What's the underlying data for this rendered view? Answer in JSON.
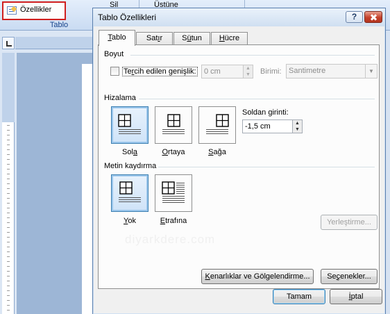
{
  "ribbon": {
    "properties_label": "Özellikler",
    "group_label": "Tablo",
    "delete_label": "Sil",
    "above_label": "Üstüne"
  },
  "dialog": {
    "title": "Tablo Özellikleri",
    "help_label": "?",
    "tabs": [
      {
        "label": "Tablo",
        "ul": "T",
        "rest": "ablo",
        "active": true
      },
      {
        "label": "Satır",
        "pre": "Sat",
        "ul": "ı",
        "rest": "r",
        "active": false
      },
      {
        "label": "Sütun",
        "pre": "S",
        "ul": "ü",
        "rest": "tun",
        "active": false
      },
      {
        "label": "Hücre",
        "ul": "H",
        "rest": "ücre",
        "active": false
      }
    ],
    "size": {
      "section_label": "Boyut",
      "preferred_width": {
        "pre": "Te",
        "ul": "r",
        "rest": "cih edilen genişlik:",
        "checked": false
      },
      "width_value": "0 cm",
      "unit_label": "Birimi:",
      "unit_value": "Santimetre"
    },
    "alignment": {
      "section_label": "Hizalama",
      "options": [
        {
          "pre": "Sol",
          "ul": "a",
          "rest": "",
          "selected": true
        },
        {
          "pre": "",
          "ul": "O",
          "rest": "rtaya",
          "selected": false
        },
        {
          "pre": "",
          "ul": "S",
          "rest": "ağa",
          "selected": false
        }
      ],
      "indent_label": {
        "pre": "Soldan ",
        "ul": "g",
        "rest": "irinti:"
      },
      "indent_value": "-1,5 cm"
    },
    "wrapping": {
      "section_label": "Metin kaydırma",
      "options": [
        {
          "pre": "",
          "ul": "Y",
          "rest": "ok",
          "selected": true
        },
        {
          "pre": "",
          "ul": "E",
          "rest": "trafına",
          "selected": false
        }
      ],
      "positioning_button": "Yerleştirme..."
    },
    "borders_button": {
      "pre": "",
      "ul": "K",
      "rest": "enarlıklar ve Gölgelendirme..."
    },
    "options_button": {
      "pre": "Se",
      "ul": "ç",
      "rest": "enekler..."
    },
    "ok_button": "Tamam",
    "cancel_button": {
      "pre": "",
      "ul": "İ",
      "rest": "ptal"
    },
    "watermark": "diyarkdere.com"
  },
  "colors": {
    "highlight_border": "#d01f1f",
    "selected_option": "#cfe3f8",
    "close_button": "#c4412b"
  },
  "icons": [
    "properties-icon",
    "ruler-tab-icon",
    "help-icon",
    "close-icon",
    "spin-up-icon",
    "spin-down-icon",
    "dropdown-arrow-icon",
    "table-align-icon",
    "text-wrap-icon"
  ]
}
